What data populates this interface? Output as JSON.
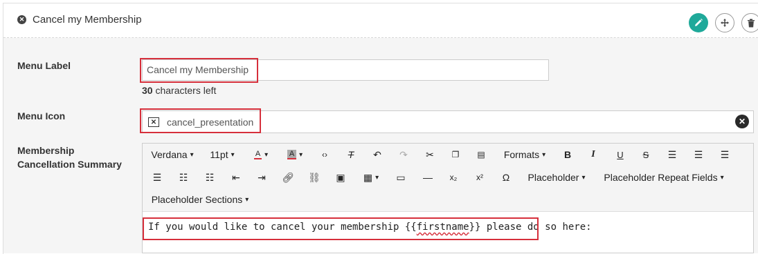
{
  "header": {
    "title": "Cancel my Membership",
    "title_icon": "x-circle-icon",
    "actions": [
      "pencil-icon",
      "move-icon",
      "trash-icon"
    ]
  },
  "menu_label": {
    "label": "Menu Label",
    "value": "Cancel my Membership",
    "chars_left_count": "30",
    "chars_left_text": "characters left"
  },
  "menu_icon": {
    "label": "Menu Icon",
    "value": "cancel_presentation",
    "icon": "cancel-presentation-icon"
  },
  "summary": {
    "label_line1": "Membership",
    "label_line2": "Cancellation Summary",
    "toolbar": {
      "font": "Verdana",
      "size": "11pt",
      "formats": "Formats",
      "placeholder": "Placeholder",
      "placeholder_repeat": "Placeholder Repeat Fields",
      "placeholder_sections": "Placeholder Sections"
    },
    "content_before": "If you would like to cancel your membership {{",
    "content_word": "firstname",
    "content_after": "}} please do so here:"
  },
  "colors": {
    "highlight": "#d62f3b",
    "accent": "#1fa99a"
  }
}
